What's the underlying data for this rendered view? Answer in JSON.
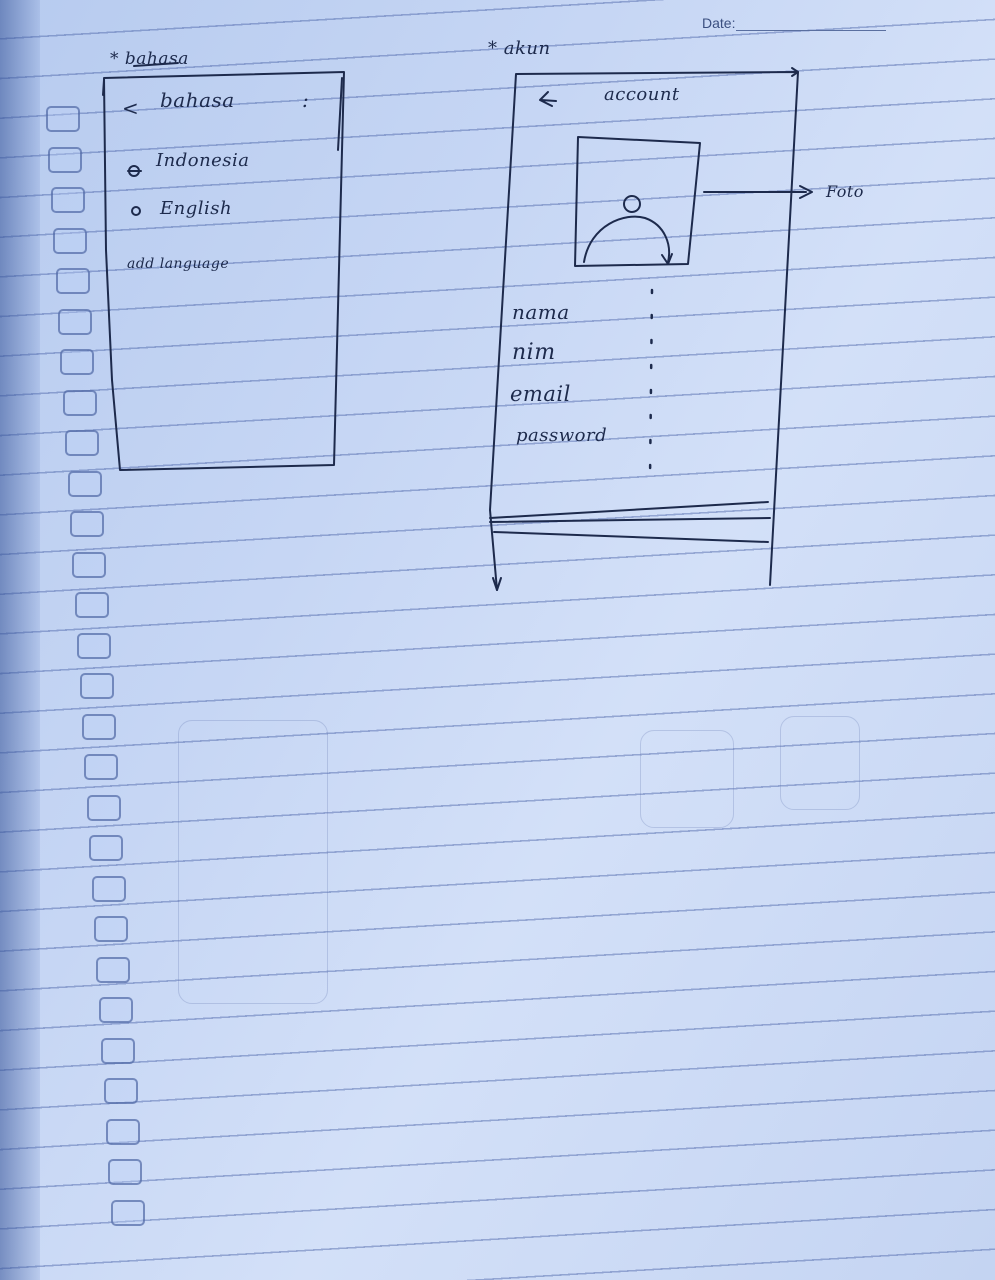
{
  "header": {
    "date_label": "Date:"
  },
  "left_sketch": {
    "heading": "* bahasa",
    "screen_title": "bahasa",
    "back_symbol": "<",
    "menu_symbol": ":",
    "options": [
      "Indonesia",
      "English"
    ],
    "add_link": "add language"
  },
  "right_sketch": {
    "heading": "* akun",
    "screen_title": "account",
    "fields": [
      "nama",
      "nim",
      "email",
      "password"
    ],
    "photo_label": "Foto"
  }
}
